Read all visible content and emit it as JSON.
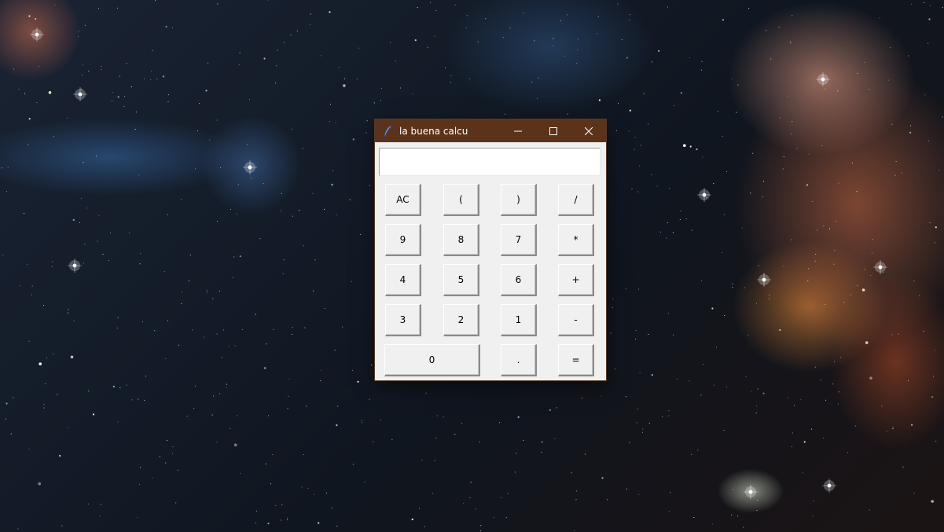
{
  "window": {
    "title": "la buena calcu",
    "title_icon": "feather-icon",
    "controls": [
      "minimize-icon",
      "maximize-icon",
      "close-icon"
    ],
    "titlebar_color": "#5b331b"
  },
  "display": {
    "value": ""
  },
  "buttons": {
    "row1": [
      "AC",
      "(",
      ")",
      "/"
    ],
    "row2": [
      "9",
      "8",
      "7",
      "*"
    ],
    "row3": [
      "4",
      "5",
      "6",
      "+"
    ],
    "row4": [
      "3",
      "2",
      "1",
      "-"
    ],
    "row5": [
      "0",
      ".",
      "="
    ]
  }
}
